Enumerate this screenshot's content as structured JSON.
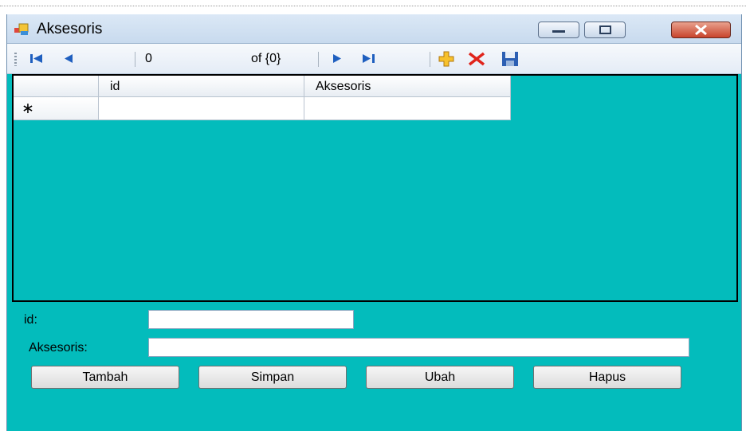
{
  "window": {
    "title": "Aksesoris"
  },
  "navigator": {
    "position": "0",
    "count_label": "of {0}"
  },
  "grid": {
    "columns": [
      "id",
      "Aksesoris"
    ],
    "new_row_marker": "∗"
  },
  "form": {
    "id_label": "id:",
    "id_value": "",
    "aksesoris_label": "Aksesoris:",
    "aksesoris_value": ""
  },
  "buttons": {
    "tambah": "Tambah",
    "simpan": "Simpan",
    "ubah": "Ubah",
    "hapus": "Hapus"
  },
  "colors": {
    "form_background": "#03bcbc",
    "close_button": "#c8442c"
  },
  "icons": [
    "move-first-icon",
    "move-previous-icon",
    "move-next-icon",
    "move-last-icon",
    "add-new-icon",
    "delete-icon",
    "save-icon"
  ]
}
